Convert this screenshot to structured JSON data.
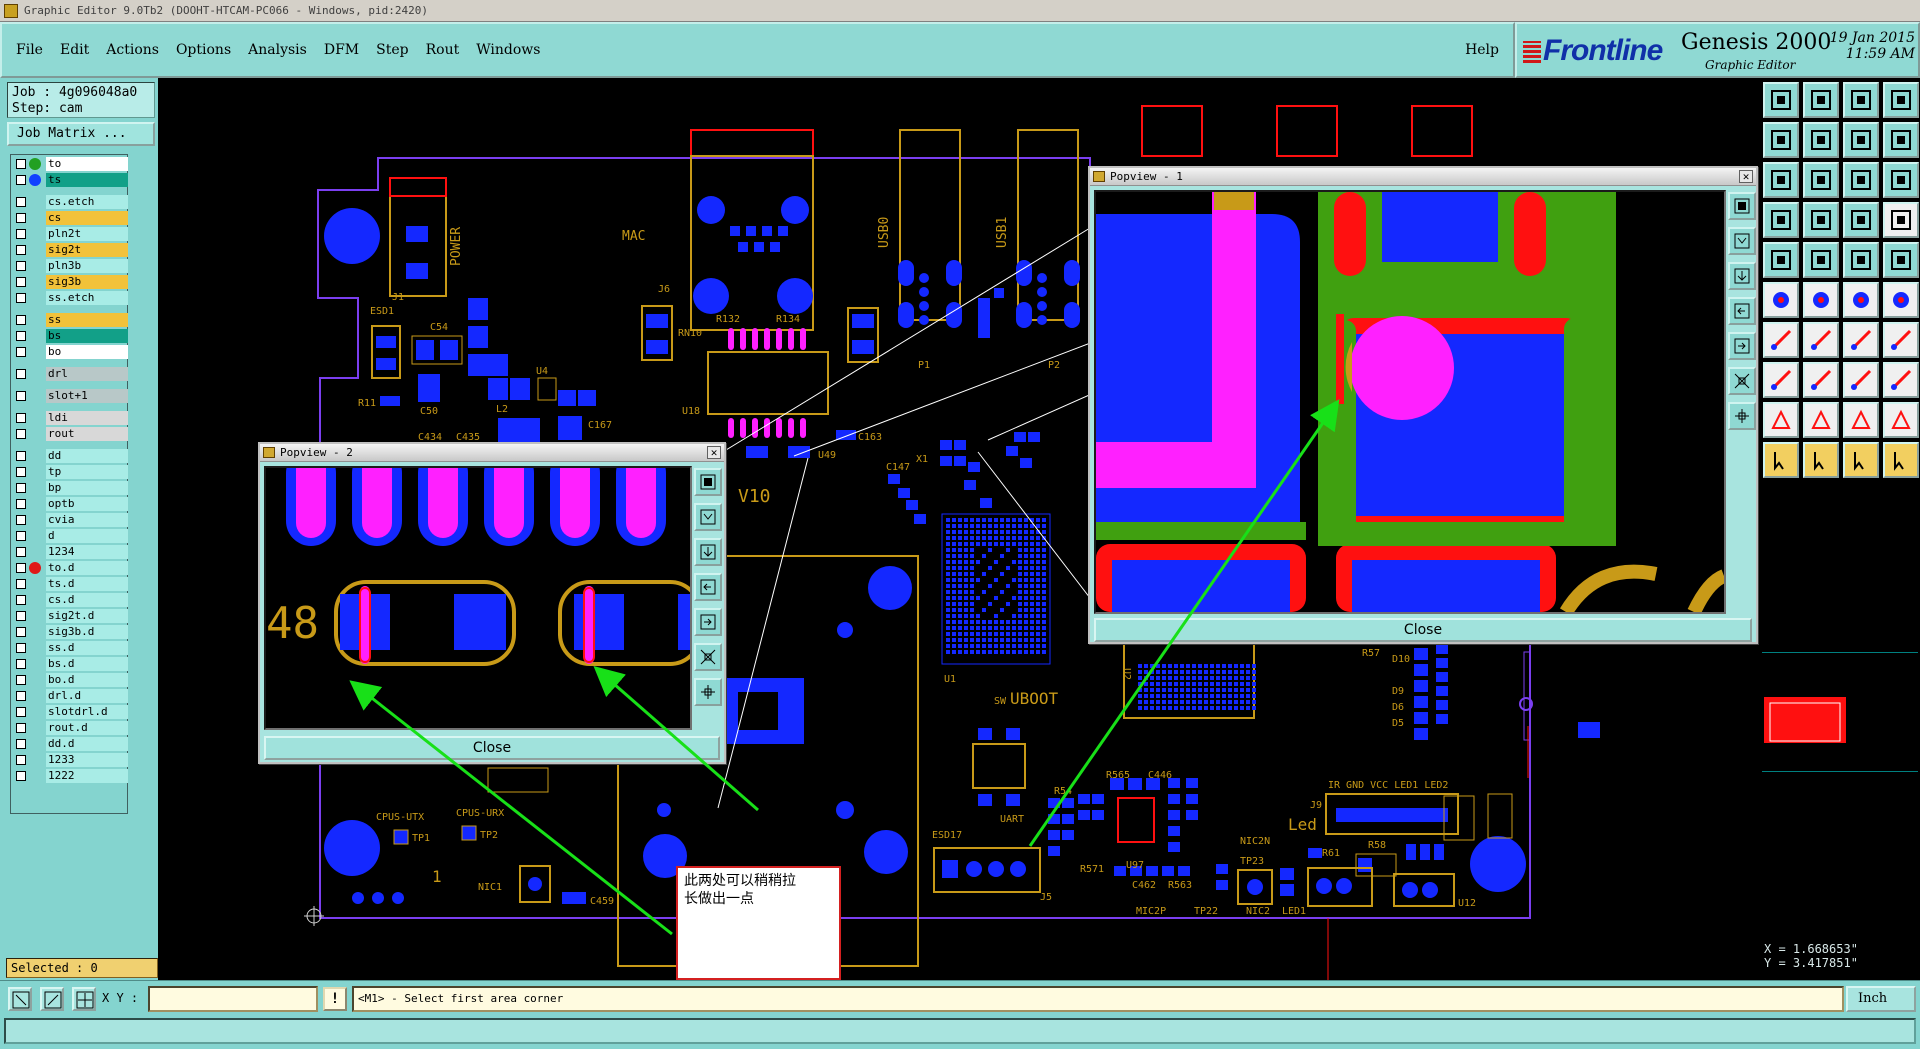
{
  "window": {
    "title": "Graphic Editor 9.0Tb2 (DOOHT-HTCAM-PC066 - Windows, pid:2420)"
  },
  "menu": {
    "items": [
      "File",
      "Edit",
      "Actions",
      "Options",
      "Analysis",
      "DFM",
      "Step",
      "Rout",
      "Windows"
    ],
    "help": "Help"
  },
  "brand": {
    "logo": "Frontline",
    "product": "Genesis 2000",
    "subtitle": "Graphic Editor",
    "date": "19 Jan 2015",
    "time": "11:59 AM"
  },
  "job": {
    "job_line": "Job : 4g096048a0",
    "step_line": "Step: cam",
    "matrix_button": "Job Matrix ..."
  },
  "layers": [
    {
      "name": "to",
      "color": "#ffffff",
      "dot": "#22a022"
    },
    {
      "name": "ts",
      "color": "#12a088",
      "dot": "#1040ff"
    },
    {
      "name": "cs.etch",
      "color": "#a8ece6",
      "dot": ""
    },
    {
      "name": "cs",
      "color": "#f2c23a",
      "dot": ""
    },
    {
      "name": "pln2t",
      "color": "#a8ece6",
      "dot": ""
    },
    {
      "name": "sig2t",
      "color": "#f2c23a",
      "dot": ""
    },
    {
      "name": "pln3b",
      "color": "#a8ece6",
      "dot": ""
    },
    {
      "name": "sig3b",
      "color": "#f2c23a",
      "dot": ""
    },
    {
      "name": "ss.etch",
      "color": "#a8ece6",
      "dot": ""
    },
    {
      "name": "ss",
      "color": "#f2c23a",
      "dot": ""
    },
    {
      "name": "bs",
      "color": "#12a088",
      "dot": ""
    },
    {
      "name": "bo",
      "color": "#ffffff",
      "dot": ""
    },
    {
      "name": "drl",
      "color": "#b8c8c8",
      "dot": ""
    },
    {
      "name": "slot+1",
      "color": "#b8c8c8",
      "dot": ""
    },
    {
      "name": "ldi",
      "color": "#d8d8d8",
      "dot": ""
    },
    {
      "name": "rout",
      "color": "#d8d8d8",
      "dot": ""
    },
    {
      "name": "dd",
      "color": "#a8ece6",
      "dot": ""
    },
    {
      "name": "tp",
      "color": "#a8ece6",
      "dot": ""
    },
    {
      "name": "bp",
      "color": "#a8ece6",
      "dot": ""
    },
    {
      "name": "optb",
      "color": "#a8ece6",
      "dot": ""
    },
    {
      "name": "cvia",
      "color": "#a8ece6",
      "dot": ""
    },
    {
      "name": "d",
      "color": "#a8ece6",
      "dot": ""
    },
    {
      "name": "1234",
      "color": "#a8ece6",
      "dot": ""
    },
    {
      "name": "to.d",
      "color": "#a8ece6",
      "dot": "#e01818"
    },
    {
      "name": "ts.d",
      "color": "#a8ece6",
      "dot": ""
    },
    {
      "name": "cs.d",
      "color": "#a8ece6",
      "dot": ""
    },
    {
      "name": "sig2t.d",
      "color": "#a8ece6",
      "dot": ""
    },
    {
      "name": "sig3b.d",
      "color": "#a8ece6",
      "dot": ""
    },
    {
      "name": "ss.d",
      "color": "#a8ece6",
      "dot": ""
    },
    {
      "name": "bs.d",
      "color": "#a8ece6",
      "dot": ""
    },
    {
      "name": "bo.d",
      "color": "#a8ece6",
      "dot": ""
    },
    {
      "name": "drl.d",
      "color": "#a8ece6",
      "dot": ""
    },
    {
      "name": "slotdrl.d",
      "color": "#a8ece6",
      "dot": ""
    },
    {
      "name": "rout.d",
      "color": "#a8ece6",
      "dot": ""
    },
    {
      "name": "dd.d",
      "color": "#a8ece6",
      "dot": ""
    },
    {
      "name": "1233",
      "color": "#a8ece6",
      "dot": ""
    },
    {
      "name": "1222",
      "color": "#a8ece6",
      "dot": ""
    }
  ],
  "selected": "Selected : 0",
  "board_labels": {
    "power": "POWER",
    "mac": "MAC",
    "usb0": "USB0",
    "usb1": "USB1",
    "v10": "V10",
    "uboot": "UBOOT",
    "uart": "UART",
    "cpus_utx": "CPUS-UTX",
    "cpus_urx": "CPUS-URX",
    "tp1": "TP1",
    "tp2": "TP2",
    "u18": "U18",
    "u1": "U1",
    "u49": "U49",
    "u97": "U97",
    "u12": "U12",
    "j1": "J1",
    "j5": "J5",
    "esd1": "ESD1",
    "esd17": "ESD17",
    "p1": "P1",
    "p2": "P2",
    "c54": "C54",
    "c50": "C50",
    "c434": "C434",
    "c435": "C435",
    "c167": "C167",
    "c163": "C163",
    "c459": "C459",
    "r11": "R11",
    "r132": "R132",
    "r134": "R134",
    "rn10": "RN10",
    "x1": "X1",
    "sw": "SW",
    "led": "Led",
    "led1": "LED1",
    "nic1": "NIC1",
    "nic2n": "NIC2N",
    "mic2p": "MIC2P",
    "tp22": "TP22",
    "tp23": "TP23",
    "header": "IR GND VCC LED1 LED2",
    "r61": "R61",
    "r58": "R58",
    "r54": "R54",
    "r565": "R565",
    "c446": "C446",
    "r571": "R571",
    "c462": "C462",
    "r563": "R563",
    "j9": "J9",
    "d10": "D10",
    "d9": "D9",
    "d6": "D6",
    "d5": "D5",
    "r57": "R57",
    "u4": "U4",
    "l2": "L2",
    "j6": "J6",
    "nic2": "NIC2",
    "led1b": "LED1",
    "marker_48": "48"
  },
  "popview2": {
    "title": "Popview - 2",
    "close": "Close",
    "label": "48"
  },
  "popview1": {
    "title": "Popview - 1",
    "close": "Close"
  },
  "annotation": {
    "line1": "此两处可以稍稍拉",
    "line2": "长做出一点"
  },
  "coords": {
    "x": "X = 1.668653\"",
    "y": "Y = 3.417851\""
  },
  "command": {
    "xy_label": "X Y :",
    "xy_value": "",
    "exclaim": "!",
    "prompt": "<M1> - Select first area corner",
    "units": "Inch"
  },
  "tools": [
    "open-step-icon",
    "save-icon",
    "home-icon",
    "window-icon",
    "zoom-left-icon",
    "zoom-right-icon",
    "pan-icon",
    "redraw-icon",
    "fit-icon",
    "center-icon",
    "one-to-one-icon",
    "help-icon",
    "snap-icon",
    "grid-icon",
    "measure-icon",
    "net-icon",
    "pad-icon",
    "line-icon",
    "dotted-icon",
    "circle-icon",
    "connect-icon",
    "cross-icon",
    "route-icon",
    "split-icon",
    "angle-icon",
    "slash-icon",
    "arc-icon",
    "fork-icon",
    "select-pad-icon",
    "dash-icon",
    "range-icon",
    "polygon-icon",
    "triangle-icon",
    "peak-icon",
    "arch-icon",
    "wave-icon",
    "pointer-icon",
    "pointer-alt-icon",
    "rotate-icon",
    "scale-icon"
  ],
  "colors": {
    "board_outline": "#7b3ff0",
    "silkscreen": "#c89a18",
    "copper": "#1428ff",
    "mask": "#ff20ff",
    "trace": "#ff1010",
    "plane": "#40a010",
    "annotation_arrow": "#18e018"
  }
}
